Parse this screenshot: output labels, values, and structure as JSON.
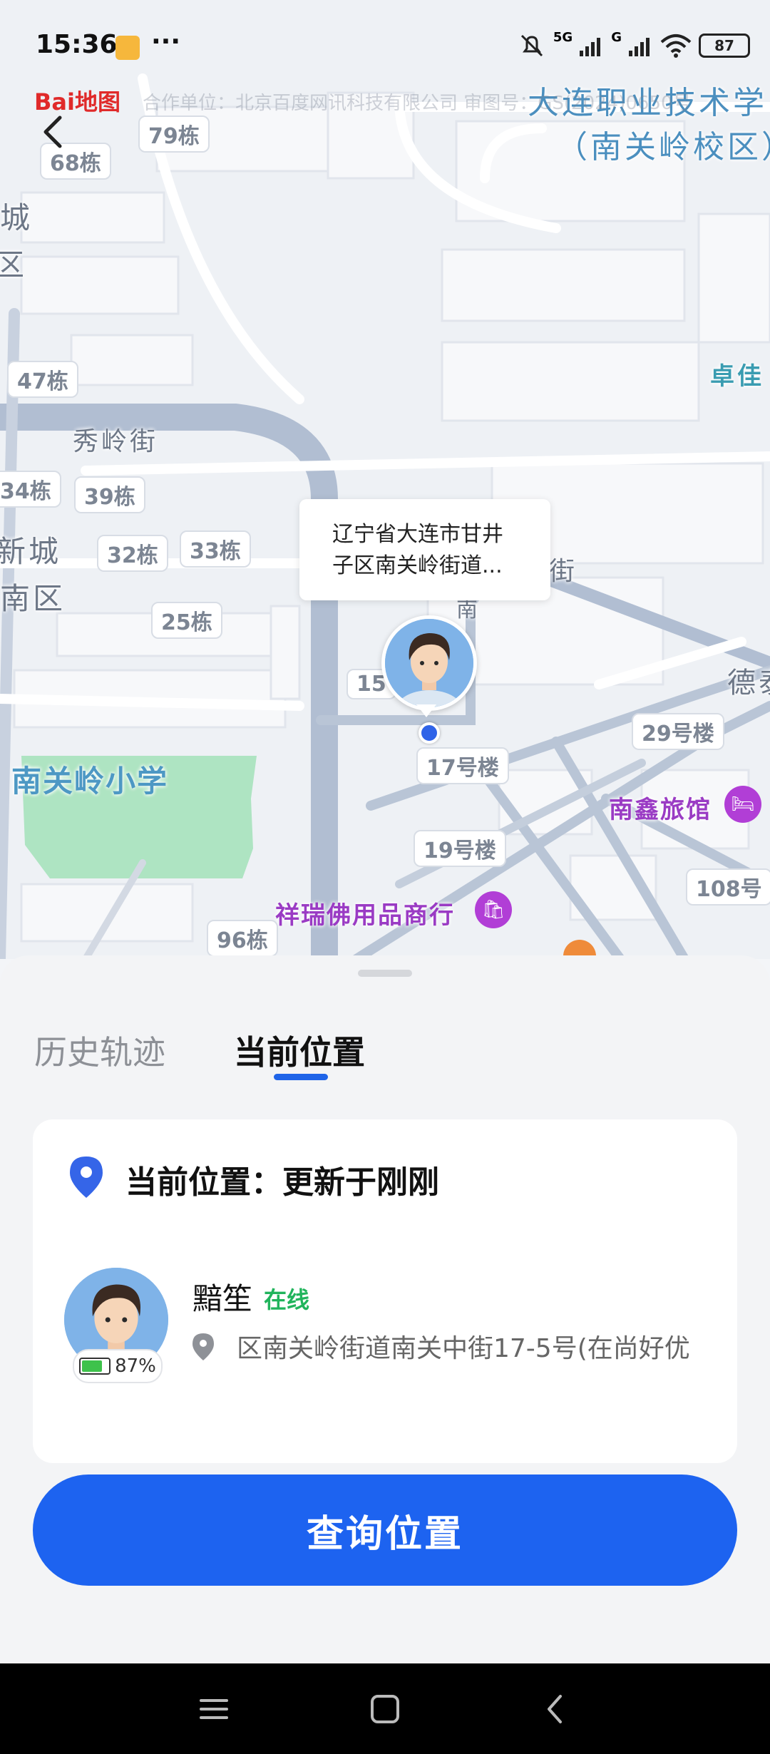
{
  "status_bar": {
    "time": "15:36",
    "more": "···",
    "network_5g": "5G",
    "network_g": "G",
    "battery": "87"
  },
  "map": {
    "provider_logo": "Bai地图",
    "copyright": "合作单位：北京百度网讯科技有限公司 审图号：GS(2024)0650号",
    "poi_college_line1": "大连职业技术学",
    "poi_college_line2": "（南关岭校区）",
    "poi_zhuojia": "卓佳",
    "street_xiuling": "秀岭街",
    "street_jie": "街",
    "street_nan": "南",
    "area_cheng": "城",
    "area_qu": "区",
    "area_xincheng": "新城",
    "area_nanqu": "南区",
    "school": "南关岭小学",
    "hotel": "南鑫旅馆",
    "shop": "祥瑞佛用品商行",
    "poi_de": "德泰",
    "buildings": [
      "79栋",
      "68栋",
      "47栋",
      "34栋",
      "39栋",
      "32栋",
      "33栋",
      "25栋",
      "15",
      "17号楼",
      "19号楼",
      "29号楼",
      "108号",
      "96栋"
    ],
    "popup_line1": "辽宁省大连市甘井",
    "popup_line2": "子区南关岭街道..."
  },
  "sheet": {
    "tab_history": "历史轨迹",
    "tab_current": "当前位置",
    "card_title": "当前位置：更新于刚刚",
    "user_name": "黯笙",
    "user_status": "在线",
    "user_battery": "87%",
    "user_address": "区南关岭街道南关中街17-5号(在尚好优",
    "query_button": "查询位置"
  },
  "colors": {
    "accent": "#1d63f0",
    "online": "#21b45c",
    "hotel_purple": "#9a3bc4"
  }
}
